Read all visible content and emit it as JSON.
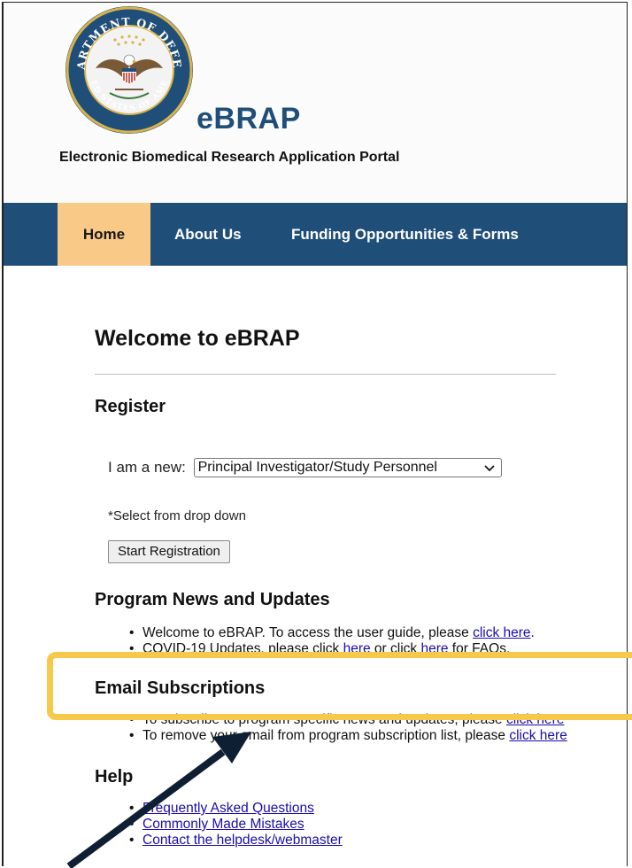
{
  "header": {
    "brand_title": "eBRAP",
    "brand_subtitle": "Electronic Biomedical Research Application Portal",
    "seal_text_top": "DEPARTMENT OF DEFENSE",
    "seal_text_bottom": "UNITED STATES OF AMERICA"
  },
  "nav": {
    "items": [
      {
        "label": "Home",
        "active": true
      },
      {
        "label": "About Us",
        "active": false
      },
      {
        "label": "Funding Opportunities & Forms",
        "active": false
      }
    ]
  },
  "main": {
    "welcome_title": "Welcome to eBRAP",
    "register": {
      "heading": "Register",
      "select_label": "I am a new:",
      "select_value": "Principal Investigator/Study Personnel",
      "select_note": "*Select from drop down",
      "button_label": "Start Registration"
    },
    "news": {
      "heading": "Program News and Updates",
      "item1_text": "Welcome to eBRAP. To access the user guide, please ",
      "item1_link": "click here",
      "item1_end": ".",
      "item2_text_a": "COVID-19 Updates, please click ",
      "item2_link_a": "here",
      "item2_text_b": " or click ",
      "item2_link_b": "here",
      "item2_text_c": " for FAQs."
    },
    "email": {
      "heading": "Email Subscriptions",
      "item1_text": "To subscribe to program specific news and updates, please ",
      "item1_link": "click here",
      "item2_text": "To remove your email from program subscription list, please ",
      "item2_link": "click here"
    },
    "help": {
      "heading": "Help",
      "links": [
        "Frequently Asked Questions",
        "Commonly Made Mistakes",
        "Contact the helpdesk/webmaster"
      ]
    }
  },
  "annotation": {
    "highlight_color": "#f7c94a",
    "arrow_color": "#0f1f33"
  },
  "colors": {
    "nav_bg": "#1f4e79",
    "nav_active_bg": "#f8c987",
    "link": "#1a0dab",
    "brand": "#1f4e79"
  }
}
